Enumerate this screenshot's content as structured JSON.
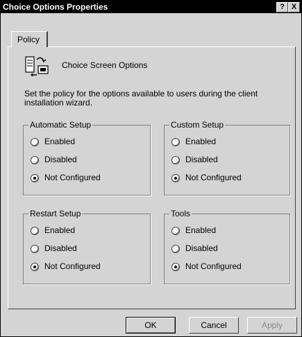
{
  "window": {
    "title": "Choice Options Properties",
    "help_label": "?",
    "close_label": "X"
  },
  "tabs": [
    {
      "label": "Policy"
    }
  ],
  "header": {
    "title": "Choice Screen Options",
    "icon": "policy-settings-icon"
  },
  "description": "Set the policy for the options available to users during the client installation wizard.",
  "options": [
    "Enabled",
    "Disabled",
    "Not Configured"
  ],
  "groups": [
    {
      "title": "Automatic Setup",
      "selected": "Not Configured"
    },
    {
      "title": "Custom Setup",
      "selected": "Not Configured"
    },
    {
      "title": "Restart Setup",
      "selected": "Not Configured"
    },
    {
      "title": "Tools",
      "selected": "Not Configured"
    }
  ],
  "buttons": {
    "ok": "OK",
    "cancel": "Cancel",
    "apply": "Apply"
  }
}
